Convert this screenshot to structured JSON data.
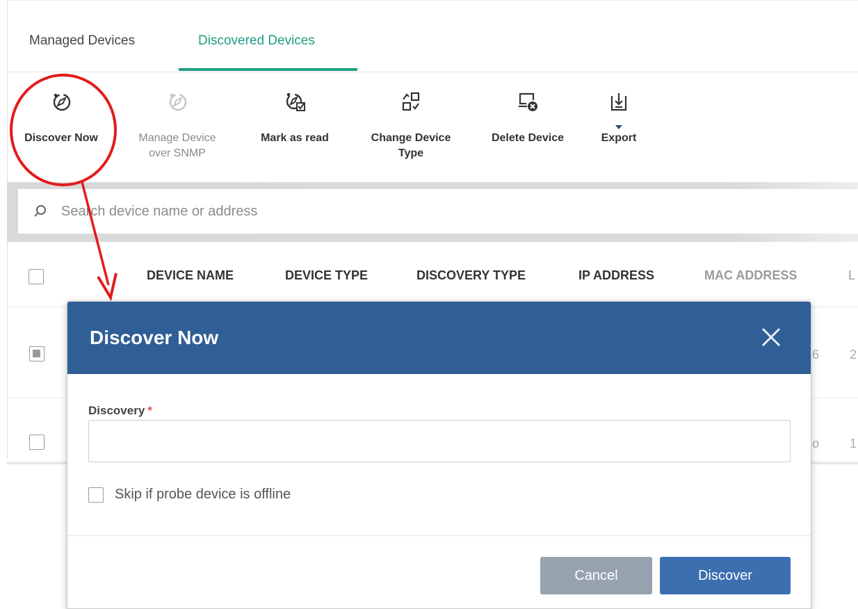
{
  "tabs": [
    {
      "label": "Managed Devices"
    },
    {
      "label": "Discovered Devices"
    }
  ],
  "toolbar": {
    "discover_now": "Discover Now",
    "manage_snmp_line1": "Manage Device",
    "manage_snmp_line2": "over SNMP",
    "mark_as_read": "Mark as read",
    "change_type_line1": "Change Device",
    "change_type_line2": "Type",
    "delete_device": "Delete Device",
    "export": "Export"
  },
  "search": {
    "placeholder": "Search device name or address"
  },
  "table": {
    "columns": [
      "DEVICE NAME",
      "DEVICE TYPE",
      "DISCOVERY TYPE",
      "IP ADDRESS",
      "MAC ADDRESS",
      "L"
    ],
    "row_edge_texts": [
      "6",
      "2",
      "o",
      "1"
    ]
  },
  "modal": {
    "title": "Discover Now",
    "field_label": "Discovery",
    "required_mark": "*",
    "field_value": "",
    "skip_label": "Skip if probe device is offline",
    "cancel": "Cancel",
    "discover": "Discover"
  },
  "colors": {
    "accent_green": "#1f9e83",
    "modal_header": "#2f5f96",
    "annotation_red": "#e31c1c",
    "button_primary": "#3c6fb0",
    "button_cancel": "#96a3af"
  }
}
